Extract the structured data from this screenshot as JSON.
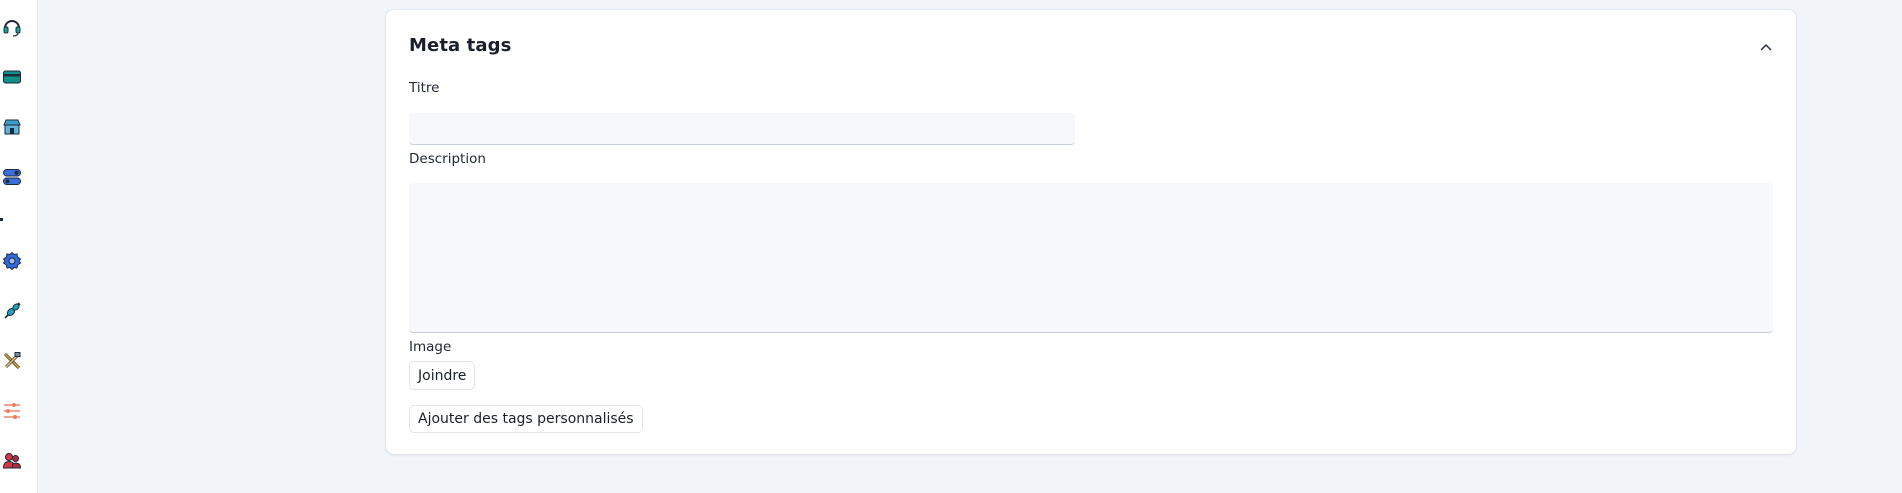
{
  "sidebar": {
    "icons": [
      {
        "name": "headset-icon",
        "color": "#16a39a"
      },
      {
        "name": "card-icon",
        "color": "#0d8f8a"
      },
      {
        "name": "store-icon",
        "color": "#3f9ec9"
      },
      {
        "name": "toggles-icon",
        "color": "#3a6fd9"
      },
      {
        "name": "gear-icon",
        "color": "#2f6bde"
      },
      {
        "name": "plug-icon",
        "color": "#1fa3b8"
      },
      {
        "name": "tools-icon",
        "color": "#d9a11f"
      },
      {
        "name": "sliders-icon",
        "color": "#ef7d63"
      },
      {
        "name": "users-icon",
        "color": "#d63447"
      }
    ]
  },
  "card": {
    "title": "Meta tags",
    "collapse_icon": "chevron-up-icon",
    "fields": {
      "titre_label": "Titre",
      "titre_value": "",
      "description_label": "Description",
      "description_value": "",
      "image_label": "Image"
    },
    "attach_button": "Joindre",
    "custom_tags_button": "Ajouter des tags personnalisés"
  }
}
